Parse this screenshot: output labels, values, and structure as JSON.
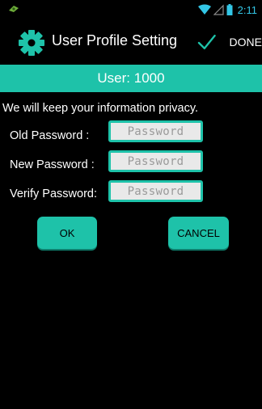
{
  "status_bar": {
    "time": "2:11",
    "icons": [
      "notification-icon",
      "wifi-icon",
      "signal-icon",
      "battery-icon"
    ],
    "accent_color": "#33c6e6"
  },
  "action_bar": {
    "app_icon": "gear-icon",
    "title": "User Profile Setting",
    "done_label": "DONE",
    "done_icon": "check-icon"
  },
  "user_header": {
    "text": "User: 1000",
    "background_color": "#1ec2a9"
  },
  "form": {
    "privacy_note": "We will keep your information privacy.",
    "fields": [
      {
        "label": "Old Password :",
        "placeholder": "Password",
        "value": ""
      },
      {
        "label": "New Password :",
        "placeholder": "Password",
        "value": ""
      },
      {
        "label": "Verify Password:",
        "placeholder": "Password",
        "value": ""
      }
    ]
  },
  "buttons": {
    "ok_label": "OK",
    "cancel_label": "CANCEL",
    "button_color": "#1ec2a9"
  }
}
